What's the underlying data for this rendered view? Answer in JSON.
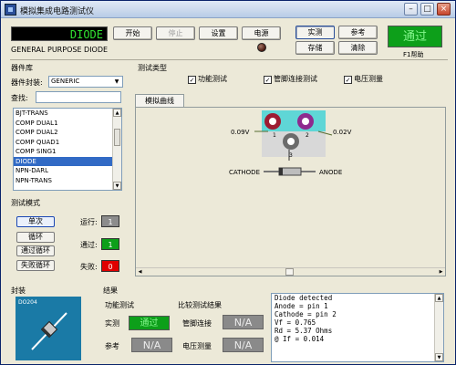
{
  "window": {
    "title": "模拟集成电路测试仪",
    "controls": {
      "minimize": "–",
      "maximize": "□",
      "close": "×"
    }
  },
  "display": {
    "device": "DIODE",
    "type_label": "GENERAL PURPOSE DIODE"
  },
  "toolbar": {
    "start": "开始",
    "stop": "停止",
    "settings": "设置",
    "power": "电源",
    "actual": "实测",
    "reference": "参考",
    "store": "存储",
    "clear": "清除"
  },
  "status": {
    "result": "通过",
    "help": "F1帮助"
  },
  "library": {
    "title": "器件库",
    "package_label": "器件封装:",
    "package_value": "GENERIC",
    "search_label": "查找:",
    "search_value": "",
    "items": [
      "BJT-TRANS",
      "COMP DUAL1",
      "COMP DUAL2",
      "COMP QUAD1",
      "COMP SING1",
      "DIODE",
      "NPN-DARL",
      "NPN-TRANS"
    ],
    "selected": "DIODE"
  },
  "test_mode": {
    "title": "测试模式",
    "buttons": [
      "单次",
      "循环",
      "通过循环",
      "失败循环"
    ],
    "run_label": "运行:",
    "run_value": "1",
    "pass_label": "通过:",
    "pass_value": "1",
    "fail_label": "失败:",
    "fail_value": "0"
  },
  "test_type": {
    "title": "测试类型",
    "function_test": "功能测试",
    "pin_connection_test": "管脚连接测试",
    "voltage_measure": "电压测量"
  },
  "tabs": {
    "sim_curve": "模拟曲线"
  },
  "diagram": {
    "pin1_voltage": "0.09V",
    "pin2_voltage": "0.02V",
    "pin1": "1",
    "pin2": "2",
    "pin3": "3",
    "cathode": "CATHODE",
    "anode": "ANODE"
  },
  "package": {
    "title": "封装",
    "name": "DO204"
  },
  "results": {
    "title": "结果",
    "function_test": "功能测试",
    "compare_results": "比较测试结果",
    "actual_label": "实测",
    "actual_value": "通过",
    "reference_label": "参考",
    "reference_value": "N/A",
    "pin_conn_label": "管脚连接",
    "pin_conn_value": "N/A",
    "voltage_label": "电压测量",
    "voltage_value": "N/A",
    "log": [
      "Diode detected",
      "Anode = pin 1",
      "Cathode = pin 2",
      "Vf = 0.765",
      "Rd = 5.37 Ohms",
      "@ If = 0.014"
    ]
  },
  "colors": {
    "pass_green": "#0d9f1a",
    "lcd_text": "#31e331",
    "selection_blue": "#316ac5",
    "fail_red": "#e00000"
  }
}
